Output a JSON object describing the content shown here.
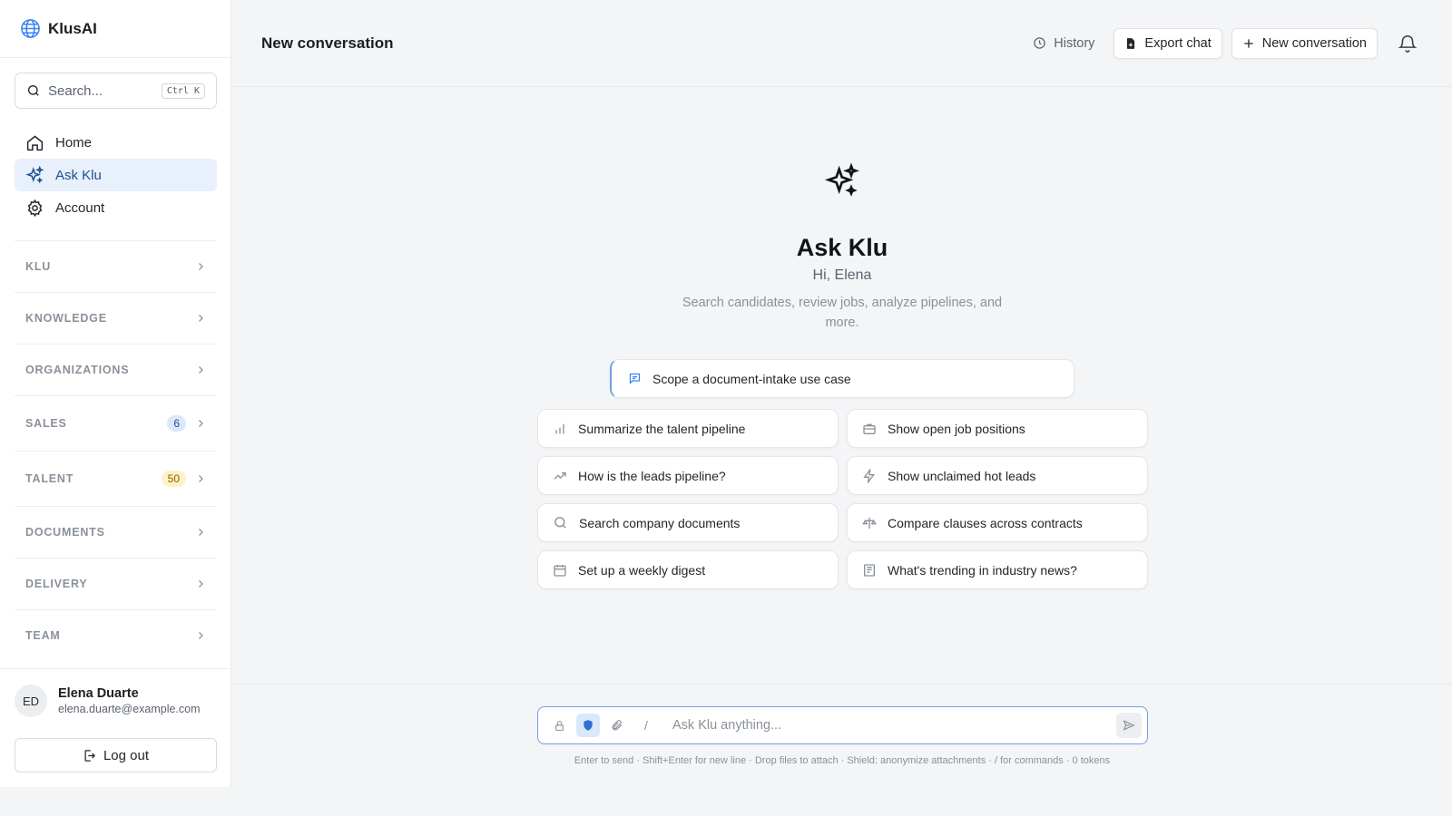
{
  "app": {
    "name": "KlusAI"
  },
  "sidebar": {
    "search": {
      "label": "Search...",
      "shortcut": "Ctrl K"
    },
    "nav": [
      {
        "label": "Home",
        "icon": "home-icon",
        "active": false
      },
      {
        "label": "Ask Klu",
        "icon": "sparkles-icon",
        "active": true
      },
      {
        "label": "Account",
        "icon": "gear-icon",
        "active": false
      }
    ],
    "sections": [
      {
        "label": "KLU"
      },
      {
        "label": "KNOWLEDGE"
      },
      {
        "label": "ORGANIZATIONS"
      },
      {
        "label": "SALES",
        "badge": "6"
      },
      {
        "label": "TALENT",
        "badge": "50"
      },
      {
        "label": "DOCUMENTS"
      },
      {
        "label": "DELIVERY"
      },
      {
        "label": "TEAM"
      }
    ],
    "user": {
      "initials": "ED",
      "name": "Elena Duarte",
      "email": "elena.duarte@example.com"
    },
    "logout_label": "Log out"
  },
  "header": {
    "title": "New conversation",
    "history_label": "History",
    "export_label": "Export chat",
    "new_label": "New conversation"
  },
  "hero": {
    "title": "Ask Klu",
    "greeting": "Hi, Elena",
    "subtitle": "Search candidates, review jobs, analyze pipelines, and more."
  },
  "featured_suggestion": "Scope a document-intake use case",
  "suggestions": [
    {
      "label": "Summarize the talent pipeline",
      "icon": "bar-chart-icon"
    },
    {
      "label": "Show open job positions",
      "icon": "briefcase-icon"
    },
    {
      "label": "How is the leads pipeline?",
      "icon": "trending-up-icon"
    },
    {
      "label": "Show unclaimed hot leads",
      "icon": "zap-icon"
    },
    {
      "label": "Search company documents",
      "icon": "search-icon"
    },
    {
      "label": "Compare clauses across contracts",
      "icon": "compare-icon"
    },
    {
      "label": "Set up a weekly digest",
      "icon": "calendar-icon"
    },
    {
      "label": "What's trending in industry news?",
      "icon": "newspaper-icon"
    }
  ],
  "composer": {
    "placeholder": "Ask Klu anything...",
    "slash": "/",
    "hint": "Enter to send · Shift+Enter for new line · Drop files to attach · Shield: anonymize attachments · / for commands · 0 tokens"
  },
  "colors": {
    "accent": "#1d4f91",
    "accent_soft": "#e8f0fb",
    "focus_border": "#6fa0e6"
  }
}
